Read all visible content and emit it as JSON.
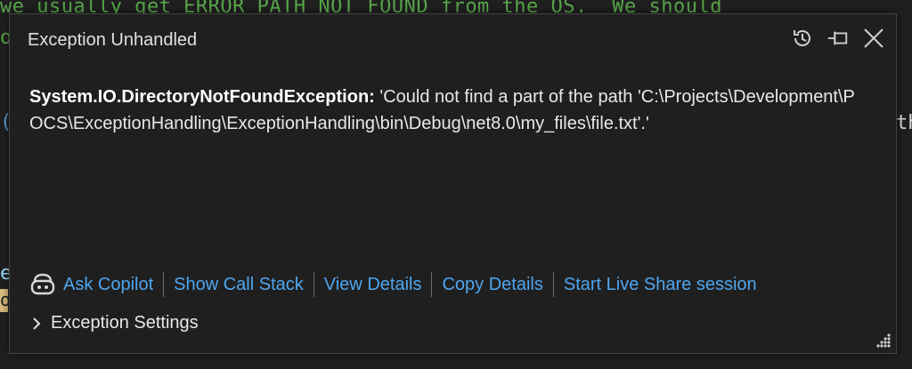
{
  "editor": {
    "code_line": "we usually get ERROR_PATH_NOT_FOUND from the OS.  We should",
    "gutter_glyphs": [
      "o",
      "(",
      "e",
      "o",
      "th"
    ]
  },
  "popup": {
    "title": "Exception Unhandled",
    "icons": [
      "history-icon",
      "pin-icon",
      "close-icon"
    ],
    "exception_type": "System.IO.DirectoryNotFoundException:",
    "exception_message": " 'Could not find a part of the path 'C:\\Projects\\Development\\POCS\\ExceptionHandling\\ExceptionHandling\\bin\\Debug\\net8.0\\my_files\\file.txt'.'",
    "links": {
      "ask_copilot": "Ask Copilot",
      "show_call_stack": "Show Call Stack",
      "view_details": "View Details",
      "copy_details": "Copy Details",
      "start_live_share": "Start Live Share session"
    },
    "exception_settings": "Exception Settings"
  },
  "colors": {
    "link": "#4fa6f0",
    "comment_green": "#57a64a",
    "background": "#1f1f1f",
    "border": "#454545"
  }
}
